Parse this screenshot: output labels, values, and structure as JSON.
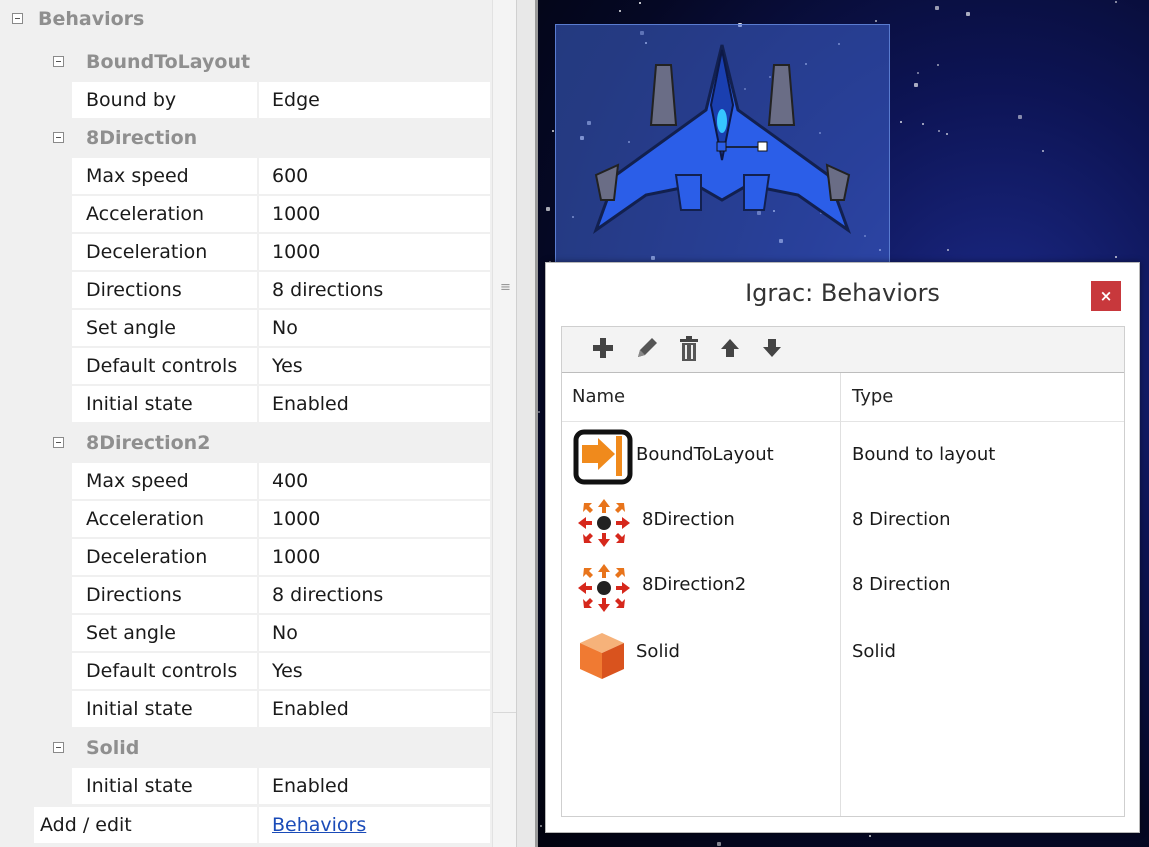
{
  "properties": {
    "section": "Behaviors",
    "groups": [
      {
        "title": "BoundToLayout",
        "props": [
          {
            "name": "Bound by",
            "value": "Edge"
          }
        ]
      },
      {
        "title": "8Direction",
        "props": [
          {
            "name": "Max speed",
            "value": "600"
          },
          {
            "name": "Acceleration",
            "value": "1000"
          },
          {
            "name": "Deceleration",
            "value": "1000"
          },
          {
            "name": "Directions",
            "value": "8 directions"
          },
          {
            "name": "Set angle",
            "value": "No"
          },
          {
            "name": "Default controls",
            "value": "Yes"
          },
          {
            "name": "Initial state",
            "value": "Enabled"
          }
        ]
      },
      {
        "title": "8Direction2",
        "props": [
          {
            "name": "Max speed",
            "value": "400"
          },
          {
            "name": "Acceleration",
            "value": "1000"
          },
          {
            "name": "Deceleration",
            "value": "1000"
          },
          {
            "name": "Directions",
            "value": "8 directions"
          },
          {
            "name": "Set angle",
            "value": "No"
          },
          {
            "name": "Default controls",
            "value": "Yes"
          },
          {
            "name": "Initial state",
            "value": "Enabled"
          }
        ]
      },
      {
        "title": "Solid",
        "props": [
          {
            "name": "Initial state",
            "value": "Enabled"
          }
        ]
      }
    ],
    "add_edit": {
      "name": "Add / edit",
      "link": "Behaviors"
    }
  },
  "dialog": {
    "title": "Igrac: Behaviors",
    "close_label": "×",
    "toolbar": [
      "add-icon",
      "edit-pencil-icon",
      "delete-trash-icon",
      "move-up-icon",
      "move-down-icon"
    ],
    "columns": {
      "name": "Name",
      "type": "Type"
    },
    "behaviors": [
      {
        "name": "BoundToLayout",
        "type": "Bound to layout",
        "icon": "bound-to-layout-icon"
      },
      {
        "name": "8Direction",
        "type": "8 Direction",
        "icon": "eight-direction-icon"
      },
      {
        "name": "8Direction2",
        "type": "8 Direction",
        "icon": "eight-direction-icon"
      },
      {
        "name": "Solid",
        "type": "Solid",
        "icon": "solid-cube-icon"
      }
    ]
  },
  "colors": {
    "close_button": "#c8383c",
    "link": "#1a4bb8",
    "section_text": "#8f8f8f",
    "ship_body": "#2b5ee8"
  }
}
